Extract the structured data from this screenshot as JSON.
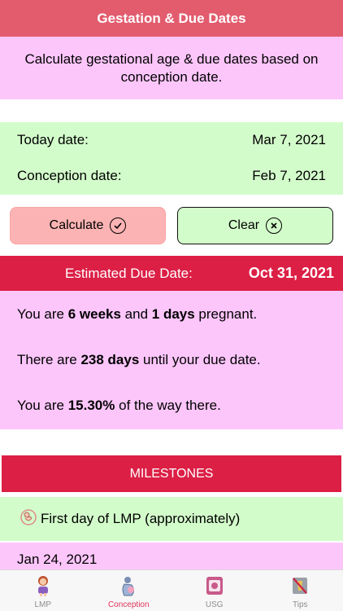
{
  "header": {
    "title": "Gestation & Due Dates"
  },
  "intro": {
    "text": "Calculate gestational age & due dates based on conception date."
  },
  "dates": {
    "today_label": "Today date:",
    "today_value": "Mar 7, 2021",
    "conception_label": "Conception date:",
    "conception_value": "Feb 7, 2021"
  },
  "buttons": {
    "calculate_label": "Calculate",
    "calculate_icon": "check-circle-icon",
    "clear_label": "Clear",
    "clear_icon": "x-circle-icon"
  },
  "due": {
    "label": "Estimated Due Date:",
    "value": "Oct 31, 2021"
  },
  "stats": {
    "line1": {
      "pre": "You are ",
      "weeks": "6 weeks",
      "mid": " and ",
      "days": "1 days",
      "post": " pregnant."
    },
    "line2": {
      "pre": "There are ",
      "days": "238 days",
      "post": " until your due date."
    },
    "line3": {
      "pre": "You are ",
      "percent": "15.30%",
      "post": " of the way there."
    }
  },
  "milestones": {
    "title": "MILESTONES",
    "items": [
      {
        "icon": "fetus-icon",
        "label": "First day of LMP (approximately)",
        "date": "Jan 24, 2021"
      }
    ]
  },
  "tabs": [
    {
      "label": "LMP",
      "icon": "woman-icon",
      "active": false
    },
    {
      "label": "Conception",
      "icon": "pregnant-icon",
      "active": true
    },
    {
      "label": "USG",
      "icon": "ultrasound-icon",
      "active": false
    },
    {
      "label": "Tips",
      "icon": "no-alcohol-icon",
      "active": false
    }
  ],
  "colors": {
    "header": "#e25c6e",
    "accent_red": "#dc1f45",
    "pink_bg": "#fdc6fb",
    "green_bg": "#d3fccb",
    "active_tab": "#e0355a"
  }
}
